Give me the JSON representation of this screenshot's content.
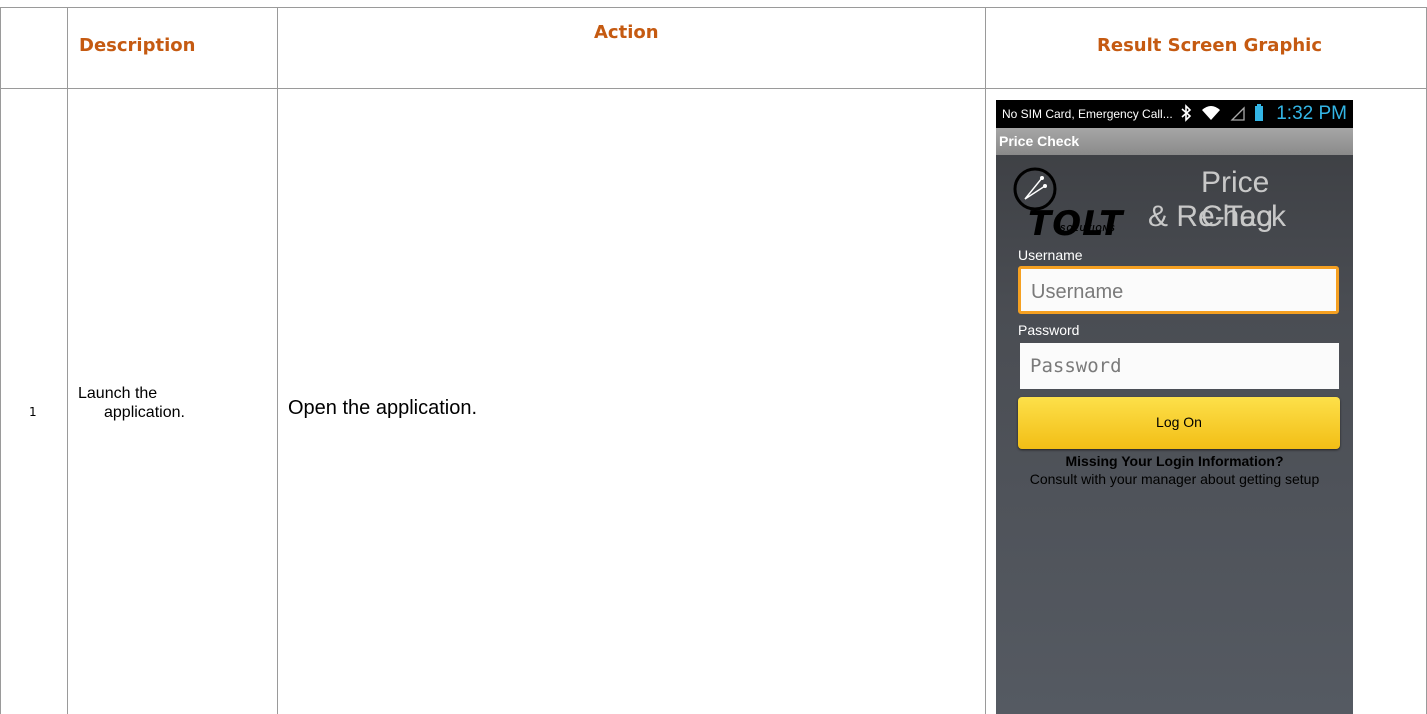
{
  "table": {
    "headers": {
      "description": "Description",
      "action": "Action",
      "result": "Result Screen Graphic"
    },
    "rows": [
      {
        "number": "1",
        "description": "Launch the application.",
        "description_line1": "Launch the",
        "description_line2": "application.",
        "action": "Open the application."
      }
    ]
  },
  "phone": {
    "status_text": "No SIM Card, Emergency Call...",
    "time": "1:32 PM",
    "app_bar_title": "Price Check",
    "logo_text": "TOLT",
    "logo_subtext": "SOLUTIONS",
    "app_title_line1": "Price Check",
    "app_title_line2": "& Re-Tag",
    "username_label": "Username",
    "username_placeholder": "Username",
    "password_label": "Password",
    "password_placeholder": "Password",
    "logon_button": "Log On",
    "missing_title": "Missing Your Login Information?",
    "missing_text": "Consult with your manager about getting setup",
    "colors": {
      "header_text": "#c55a11",
      "focus_border": "#f5a021",
      "button": "#f7c81f",
      "clock": "#33b5e5"
    }
  }
}
